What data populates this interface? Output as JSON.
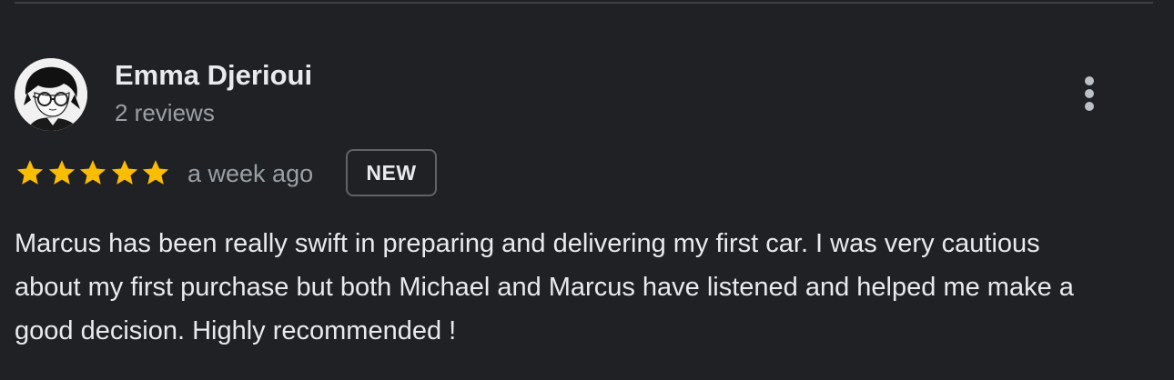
{
  "review": {
    "reviewer_name": "Emma Djerioui",
    "review_count": "2 reviews",
    "rating": 5,
    "max_rating": 5,
    "time_ago": "a week ago",
    "badge": "NEW",
    "text": "Marcus has been really swift in preparing and delivering my first car. I was very cautious about my first purchase but both Michael and Marcus have listened and helped me make a good decision. Highly recommended !"
  },
  "icons": {
    "star": "star-icon",
    "more": "more-vert-icon",
    "avatar": "avatar-illustration"
  },
  "colors": {
    "background": "#202124",
    "star": "#fbbc04",
    "primary_text": "#e8eaed",
    "secondary_text": "#9aa0a6"
  }
}
